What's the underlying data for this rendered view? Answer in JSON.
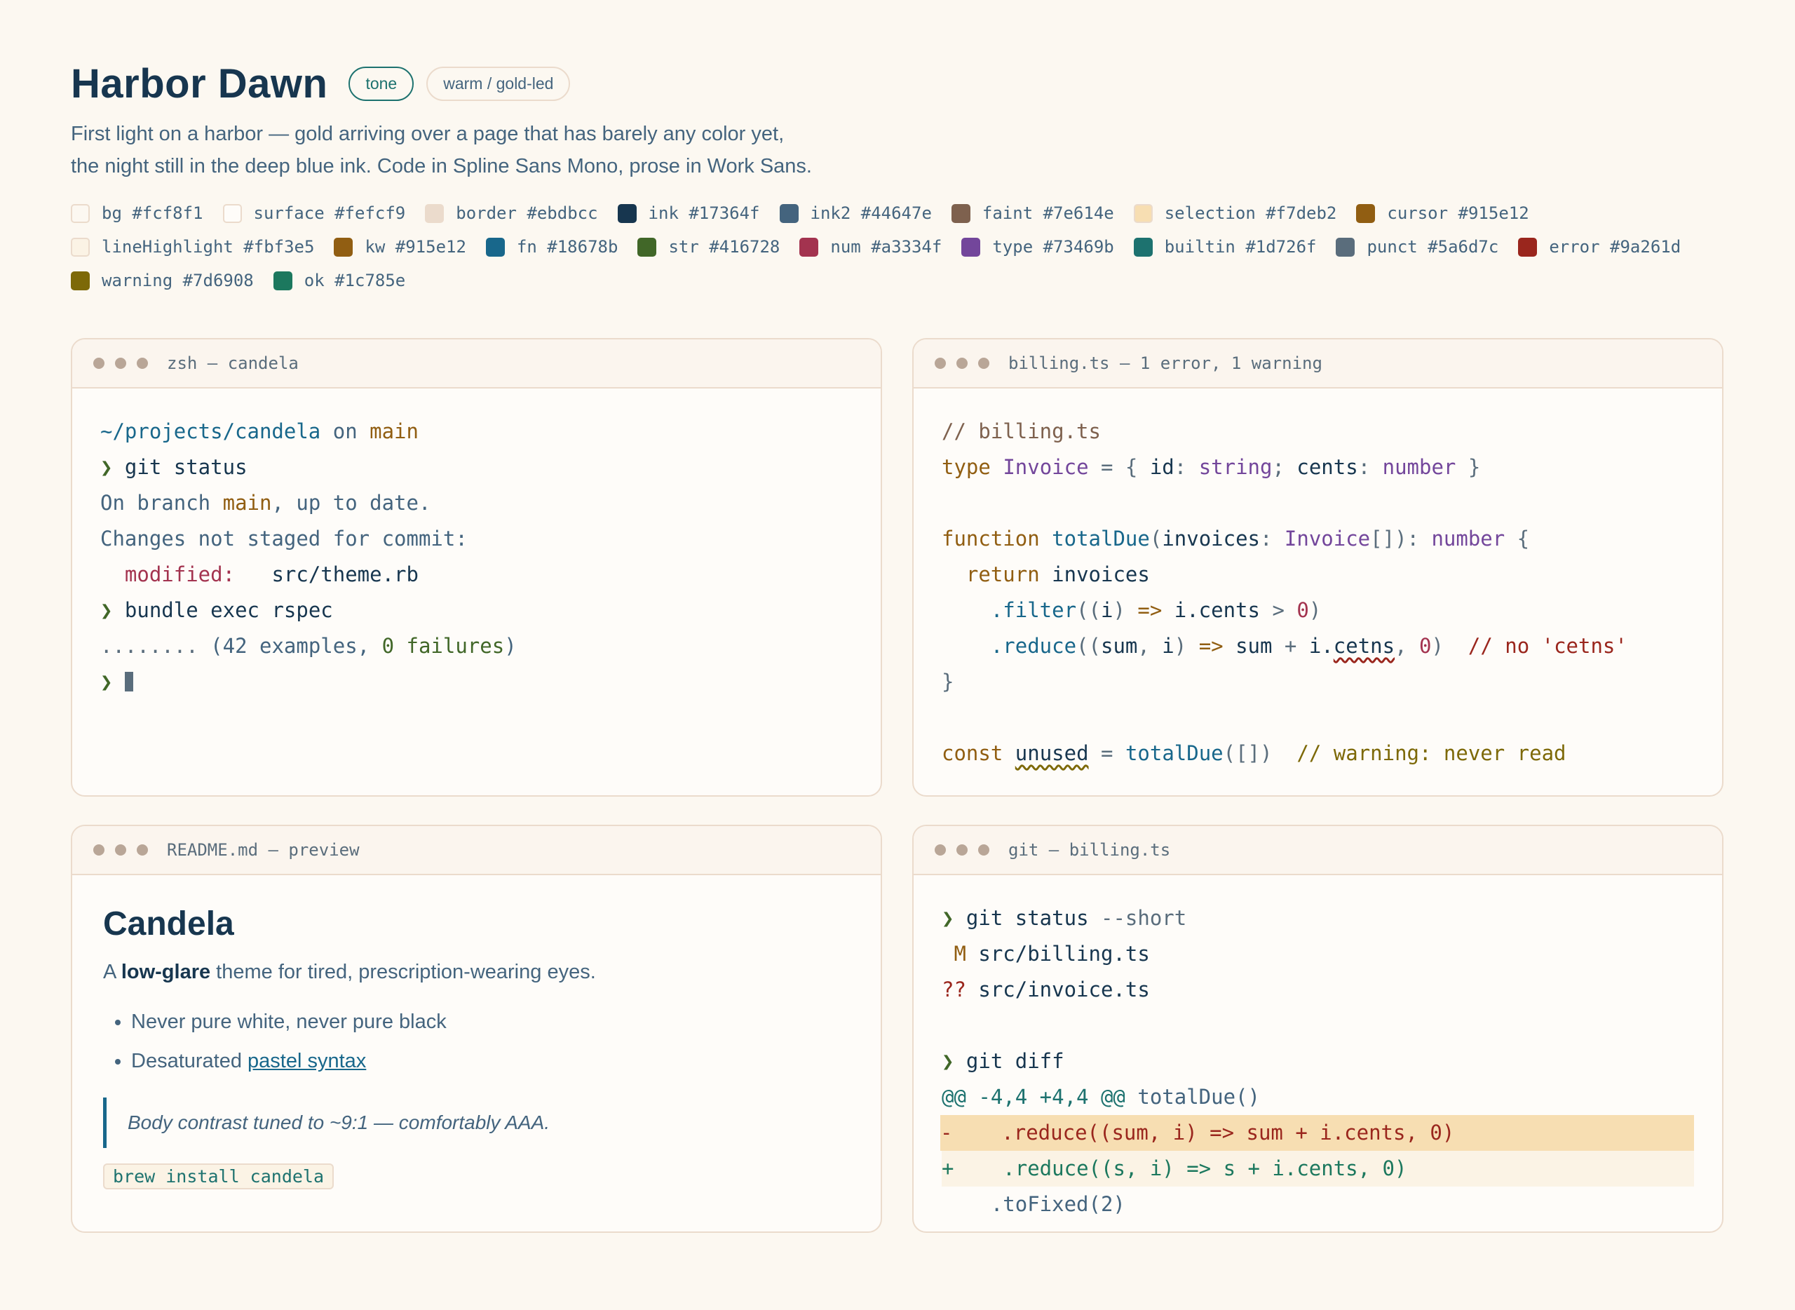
{
  "header": {
    "title": "Harbor Dawn",
    "tag_tone": "tone",
    "tag_warm": "warm / gold-led",
    "subtitle_1": "First light on a harbor — gold arriving over a page that has barely any color yet,",
    "subtitle_2": "the night still in the deep blue ink. Code in Spline Sans Mono, prose in Work Sans."
  },
  "swatches": [
    {
      "label": "bg #fcf8f1",
      "color": "#fcf8f1"
    },
    {
      "label": "surface #fefcf9",
      "color": "#fefcf9"
    },
    {
      "label": "border #ebdbcc",
      "color": "#ebdbcc"
    },
    {
      "label": "ink #17364f",
      "color": "#17364f"
    },
    {
      "label": "ink2 #44647e",
      "color": "#44647e"
    },
    {
      "label": "faint #7e614e",
      "color": "#7e614e"
    },
    {
      "label": "selection #f7deb2",
      "color": "#f7deb2"
    },
    {
      "label": "cursor #915e12",
      "color": "#915e12"
    },
    {
      "label": "lineHighlight #fbf3e5",
      "color": "#fbf3e5"
    },
    {
      "label": "kw #915e12",
      "color": "#915e12"
    },
    {
      "label": "fn #18678b",
      "color": "#18678b"
    },
    {
      "label": "str #416728",
      "color": "#416728"
    },
    {
      "label": "num #a3334f",
      "color": "#a3334f"
    },
    {
      "label": "type #73469b",
      "color": "#73469b"
    },
    {
      "label": "builtin #1d726f",
      "color": "#1d726f"
    },
    {
      "label": "punct #5a6d7c",
      "color": "#5a6d7c"
    },
    {
      "label": "error #9a261d",
      "color": "#9a261d"
    },
    {
      "label": "warning #7d6908",
      "color": "#7d6908"
    },
    {
      "label": "ok #1c785e",
      "color": "#1c785e"
    }
  ],
  "terminal": {
    "title": "zsh — candela",
    "path": "~/projects/candela",
    "on": " on ",
    "branch": "main",
    "prompt": "❯",
    "cmd1": " git status",
    "out1_a": "On branch ",
    "out1_b": "main",
    "out1_c": ", up to date.",
    "out2": "Changes not staged for commit:",
    "out3_a": "  modified:",
    "out3_b": "   src/theme.rb",
    "cmd2": " bundle exec rspec",
    "out4_a": "........",
    "out4_b": " (42 examples, ",
    "out4_c": "0 failures",
    "out4_d": ")"
  },
  "editor": {
    "title": "billing.ts — 1 error, 1 warning",
    "l1": "// billing.ts",
    "l2_kw": "type",
    "l2_ty": "Invoice",
    "l2_eq": " = { ",
    "l2_id": "id",
    "l2_c1": ": ",
    "l2_string": "string",
    "l2_semi": "; ",
    "l2_cents": "cents",
    "l2_c2": ": ",
    "l2_number": "number",
    "l2_end": " }",
    "l4_kw": "function",
    "l4_fn": "totalDue",
    "l4_p1": "(",
    "l4_arg": "invoices",
    "l4_c": ": ",
    "l4_ty": "Invoice",
    "l4_br": "[]",
    "l4_p2": "): ",
    "l4_ret": "number",
    "l4_brace": " {",
    "l5_kw": "return",
    "l5_id": " invoices",
    "l6_fn": ".filter",
    "l6_a": "((",
    "l6_i": "i",
    "l6_b": ") ",
    "l6_arrow": "=>",
    "l6_c": " i.cents ",
    "l6_gt": ">",
    "l6_zero": "0",
    "l6_d": ")",
    "l7_fn": ".reduce",
    "l7_a": "((",
    "l7_sum": "sum",
    "l7_comma": ", ",
    "l7_i": "i",
    "l7_b": ") ",
    "l7_arrow": "=>",
    "l7_c": " sum ",
    "l7_plus": "+",
    "l7_d": " i.",
    "l7_bad": "cetns",
    "l7_e": ", ",
    "l7_zero": "0",
    "l7_f": ")",
    "l7_comment": "// no 'cetns'",
    "l8": "}",
    "l10_kw": "const",
    "l10_unused": "unused",
    "l10_eq": " = ",
    "l10_fn": "totalDue",
    "l10_args": "([])",
    "l10_comment": "// warning: never read"
  },
  "readme": {
    "title": "README.md — preview",
    "heading": "Candela",
    "lead_a": "A ",
    "lead_b": "low-glare",
    "lead_c": " theme for tired, prescription-wearing eyes.",
    "bullet1": "Never pure white, never pure black",
    "bullet2_a": "Desaturated ",
    "bullet2_link": "pastel syntax",
    "quote": "Body contrast tuned to ~9:1 — comfortably AAA.",
    "code": "brew install candela"
  },
  "git": {
    "title": "git — billing.ts",
    "prompt": "❯",
    "cmd1": " git status",
    "cmd1_flag": " --short",
    "m_flag": " M",
    "m_file": " src/billing.ts",
    "q_flag": "??",
    "q_file": " src/invoice.ts",
    "cmd2": " git diff",
    "hunk": "@@ -4,4 +4,4 @@",
    "hunk_fn": " totalDue()",
    "del_sign": "-",
    "del_code": "    .reduce((sum, i) => sum + i.cents, 0)",
    "add_sign": "+",
    "add_code": "    .reduce((s, i) => s + i.cents, 0)",
    "ctx": "    .toFixed(2)"
  }
}
